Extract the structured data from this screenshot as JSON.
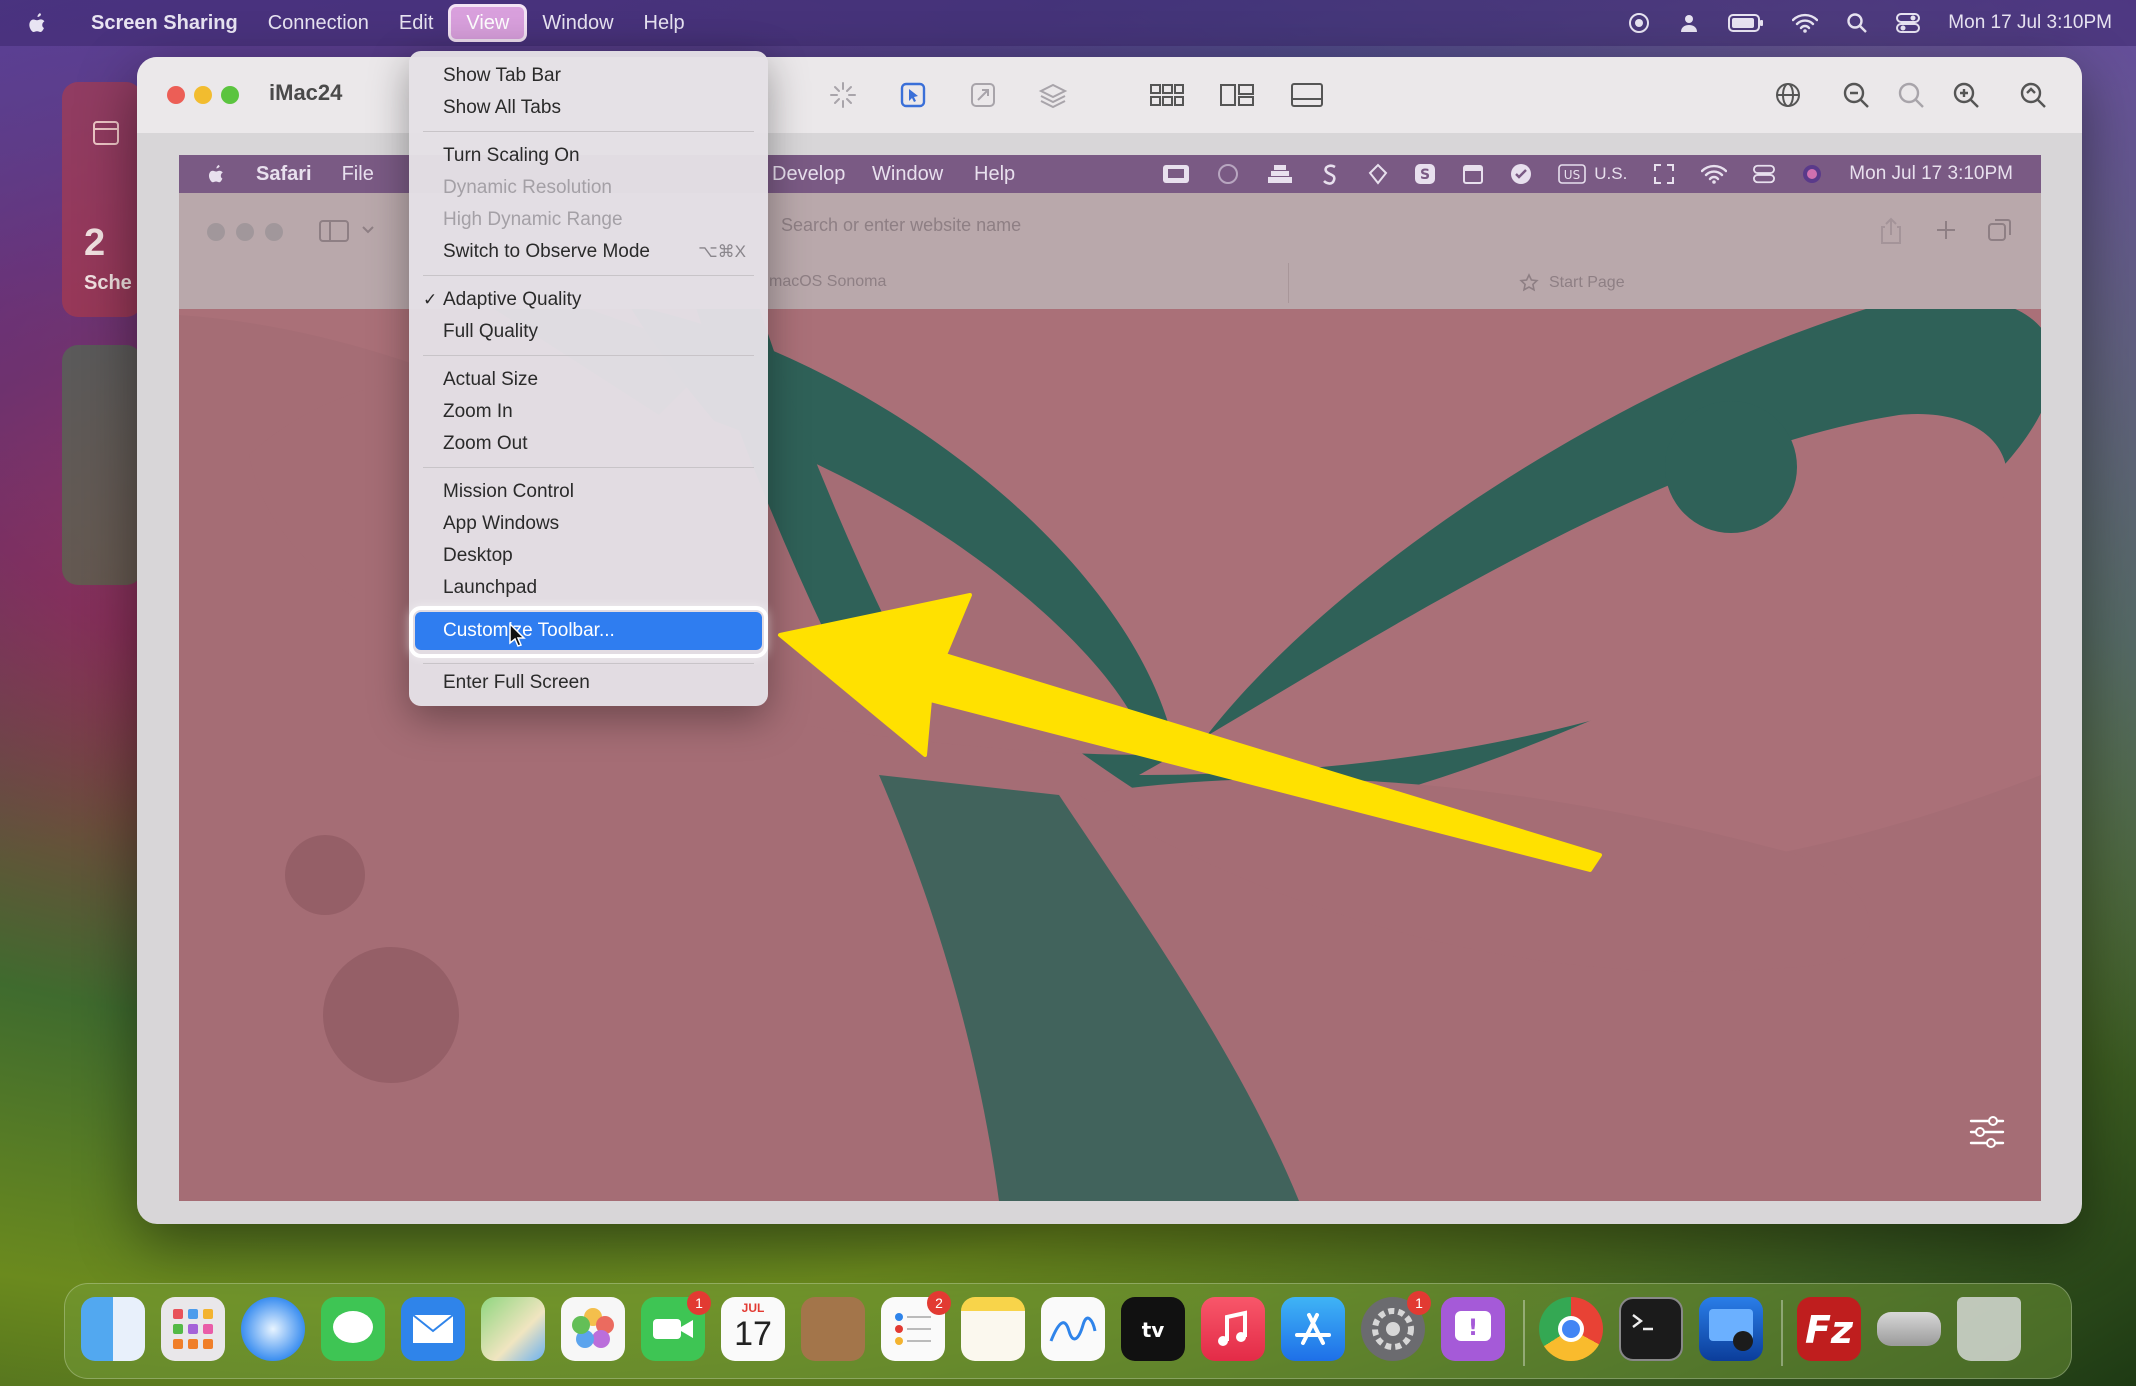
{
  "menubar": {
    "app_name": "Screen Sharing",
    "items": [
      "Connection",
      "Edit",
      "View",
      "Window",
      "Help"
    ],
    "active_item": "View",
    "clock": "Mon 17 Jul  3:10PM"
  },
  "window": {
    "title": "iMac24"
  },
  "remote": {
    "menubar": {
      "app_name": "Safari",
      "items_left": [
        "File"
      ],
      "items_right": [
        "Develop",
        "Window",
        "Help"
      ],
      "input_source": "U.S.",
      "clock": "Mon Jul 17  3:10PM"
    },
    "safari": {
      "address_placeholder": "Search or enter website name",
      "tab1": "macOS Sonoma",
      "tab2": "Start Page"
    }
  },
  "dropdown": {
    "items": [
      {
        "label": "Show Tab Bar",
        "enabled": true
      },
      {
        "label": "Show All Tabs",
        "enabled": true
      },
      {
        "label": "Turn Scaling On",
        "enabled": true
      },
      {
        "label": "Dynamic Resolution",
        "enabled": false
      },
      {
        "label": "High Dynamic Range",
        "enabled": false
      },
      {
        "label": "Switch to Observe Mode",
        "enabled": true,
        "shortcut": "⌥⌘X"
      },
      {
        "label": "Adaptive Quality",
        "enabled": true,
        "checked": true
      },
      {
        "label": "Full Quality",
        "enabled": true
      },
      {
        "label": "Actual Size",
        "enabled": true
      },
      {
        "label": "Zoom In",
        "enabled": true
      },
      {
        "label": "Zoom Out",
        "enabled": true
      },
      {
        "label": "Mission Control",
        "enabled": true
      },
      {
        "label": "App Windows",
        "enabled": true
      },
      {
        "label": "Desktop",
        "enabled": true
      },
      {
        "label": "Launchpad",
        "enabled": true
      },
      {
        "label": "Customize Toolbar...",
        "enabled": true,
        "highlighted": true
      },
      {
        "label": "Enter Full Screen",
        "enabled": true
      }
    ],
    "check_glyph": "✓"
  },
  "widgets": {
    "calendar_count": "2",
    "calendar_label": "Sche"
  },
  "dock": {
    "badges": {
      "facetime": "1",
      "calendar_month": "JUL",
      "calendar_day": "17",
      "reminders": "2",
      "settings": "1"
    },
    "apps": [
      "finder-icon",
      "launchpad-icon",
      "safari-icon",
      "messages-icon",
      "mail-icon",
      "maps-icon",
      "photos-icon",
      "facetime-icon",
      "calendar-icon",
      "contacts-icon",
      "reminders-icon",
      "notes-icon",
      "freeform-icon",
      "tv-icon",
      "music-icon",
      "app-store-icon",
      "system-settings-icon",
      "feedback-icon",
      "chrome-icon",
      "terminal-icon",
      "screen-sharing-icon",
      "filezilla-icon",
      "drive-icon",
      "trash-icon"
    ]
  },
  "colors": {
    "highlight": "#2f7df0",
    "arrow": "#ffe100",
    "remote_pink": "#aa7078",
    "remote_green": "#2f6158"
  }
}
